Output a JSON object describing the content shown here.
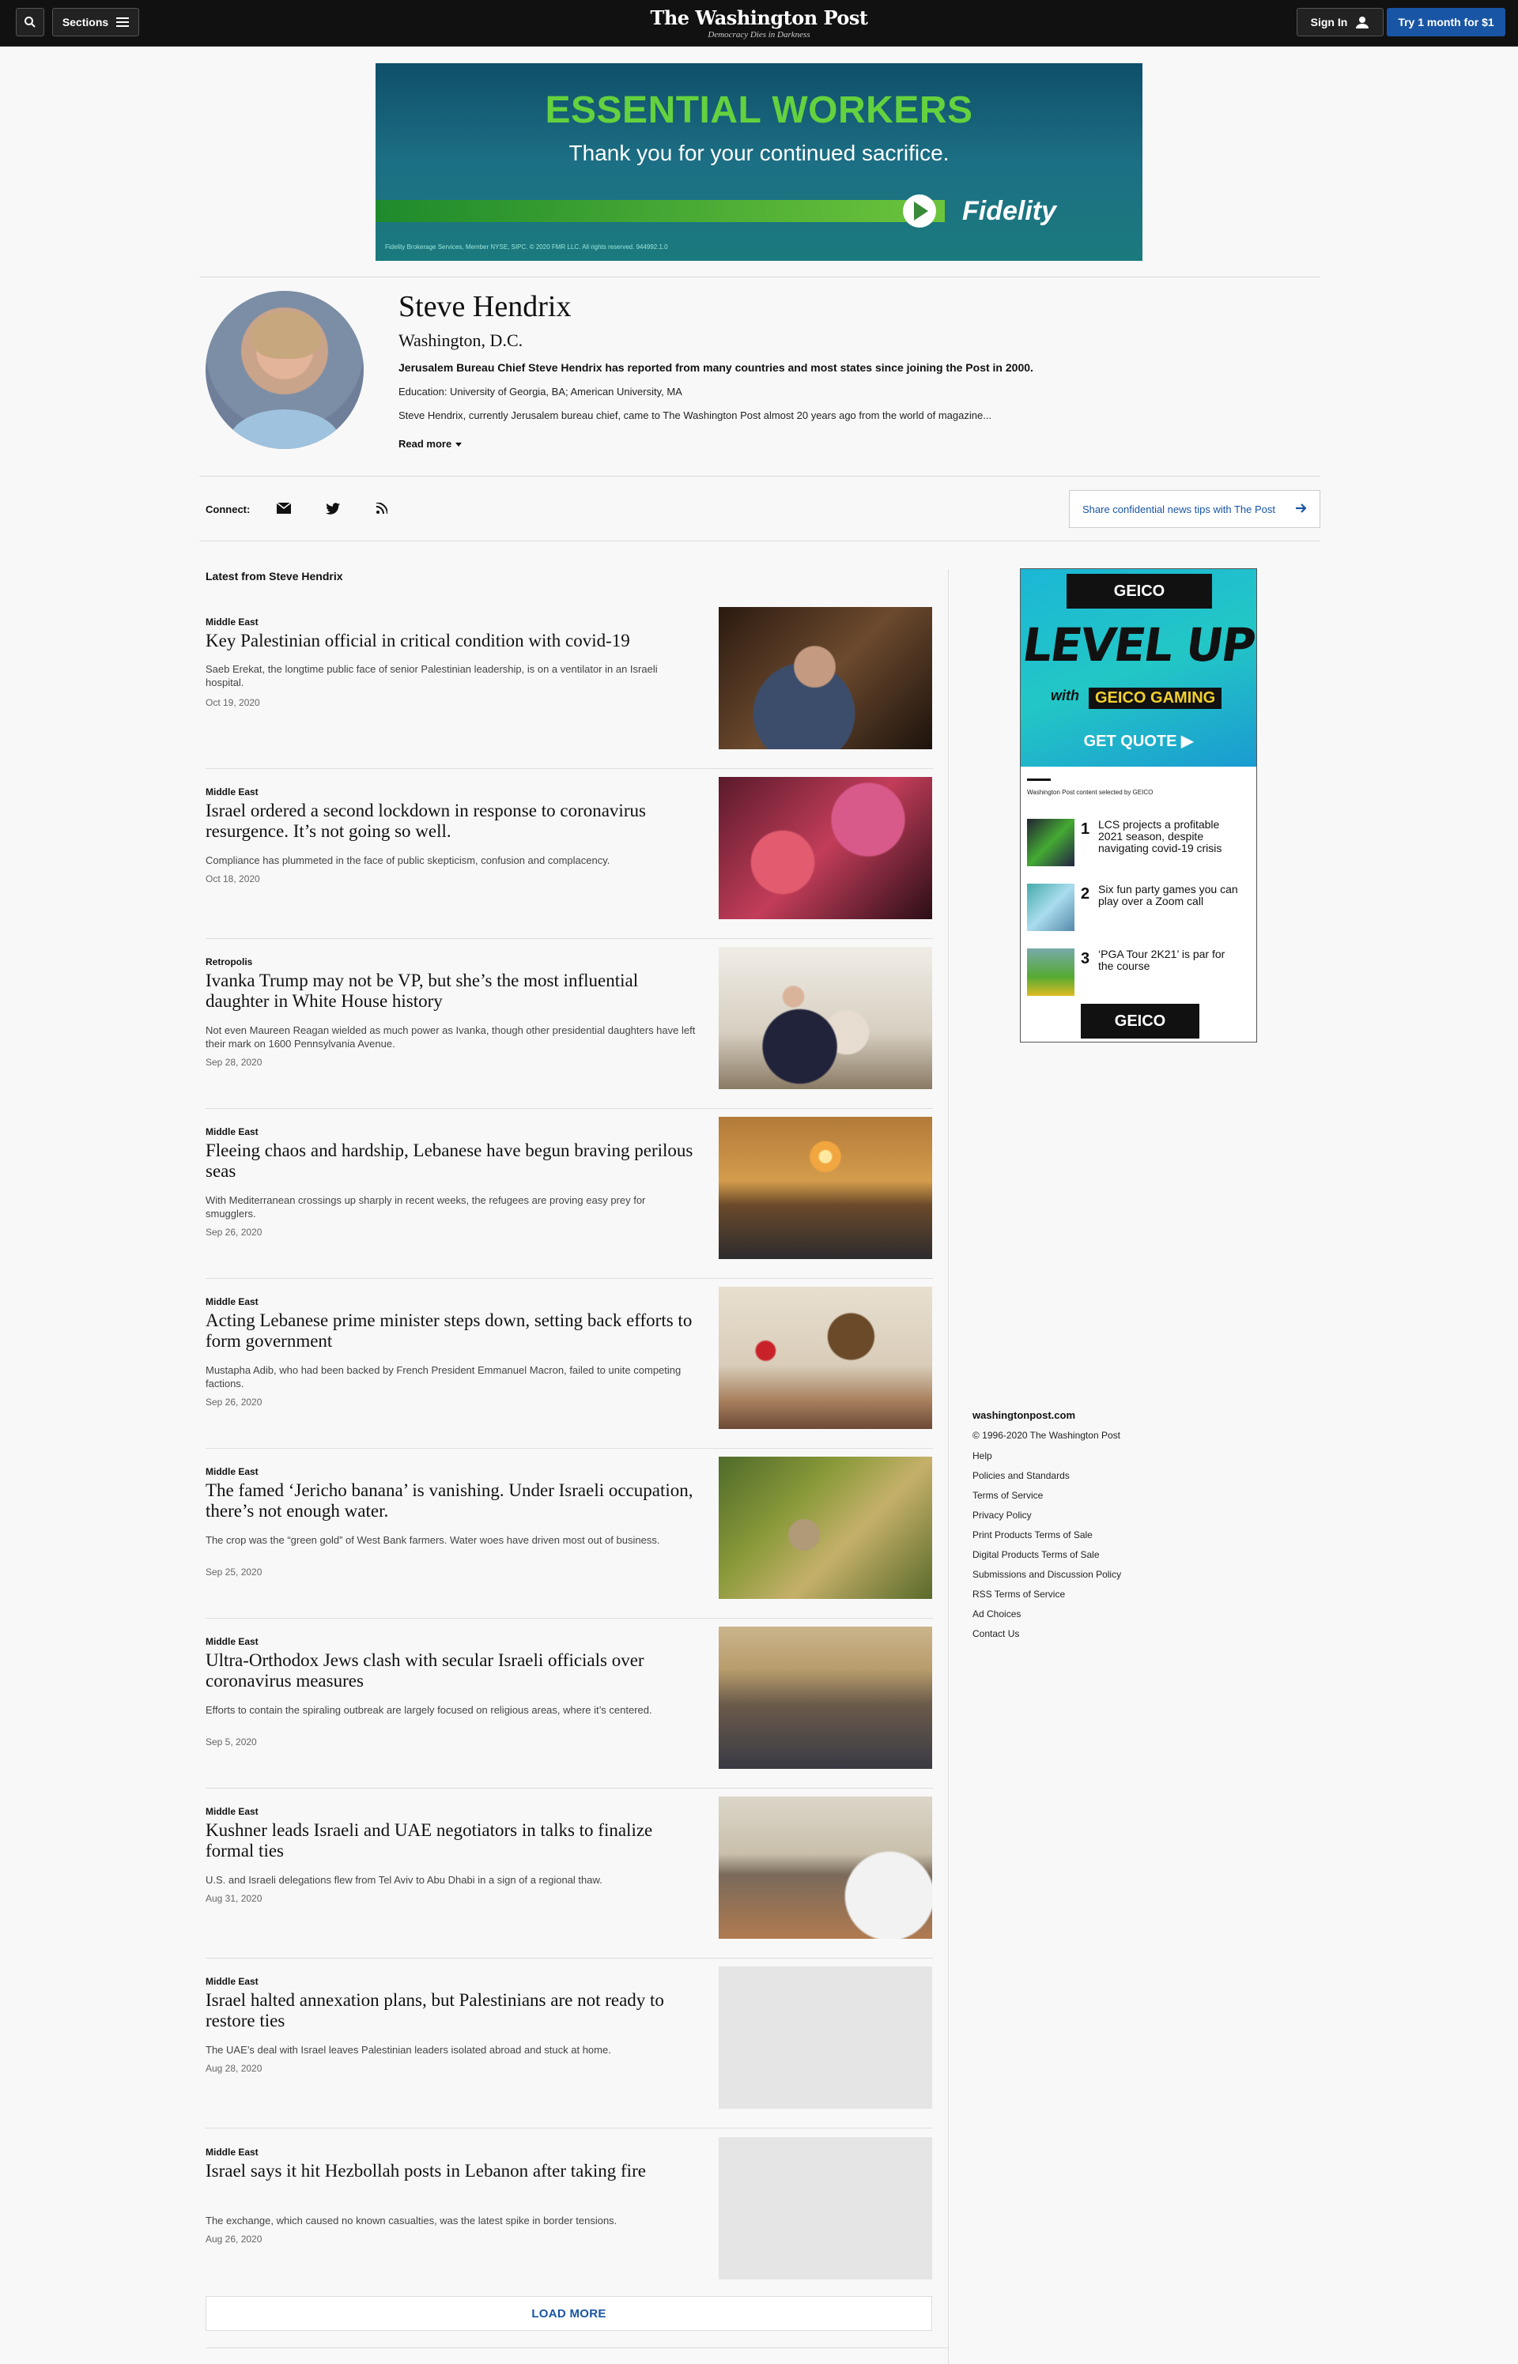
{
  "header": {
    "sections_label": "Sections",
    "brand": "The Washington Post",
    "tagline": "Democracy Dies in Darkness",
    "signin_label": "Sign In",
    "try_label": "Try 1 month for $1"
  },
  "top_ad": {
    "headline": "ESSENTIAL WORKERS",
    "subline": "Thank you for your continued sacrifice.",
    "brand": "Fidelity",
    "fine_print": "Fidelity Brokerage Services, Member NYSE, SIPC. © 2020 FMR LLC. All rights reserved. 944992.1.0"
  },
  "profile": {
    "name": "Steve Hendrix",
    "location": "Washington, D.C.",
    "bio": "Jerusalem Bureau Chief Steve Hendrix has reported from many countries and most states since joining the Post in 2000.",
    "education": "Education: University of Georgia, BA; American University, MA",
    "description": "Steve Hendrix, currently Jerusalem bureau chief, came to The Washington Post almost 20 years ago from the world of magazine...",
    "read_more": "Read more"
  },
  "connect": {
    "label": "Connect:",
    "share_text": "Share confidential news tips with The Post"
  },
  "latest_label": "Latest from Steve Hendrix",
  "articles": [
    {
      "kicker": "Middle East",
      "title": "Key Palestinian official in critical condition with covid-19",
      "blurb": "Saeb Erekat, the longtime public face of senior Palestinian leadership, is on a ventilator in an Israeli hospital.",
      "date": "Oct 19, 2020"
    },
    {
      "kicker": "Middle East",
      "title": "Israel ordered a second lockdown in response to coronavirus resurgence. It’s not going so well.",
      "blurb": "Compliance has plummeted in the face of public skepticism, confusion and complacency.",
      "date": "Oct 18, 2020"
    },
    {
      "kicker": "Retropolis",
      "title": "Ivanka Trump may not be VP, but she’s the most influential daughter in White House history",
      "blurb": "Not even Maureen Reagan wielded as much power as Ivanka, though other presidential daughters have left their mark on 1600 Pennsylvania Avenue.",
      "date": "Sep 28, 2020"
    },
    {
      "kicker": "Middle East",
      "title": "Fleeing chaos and hardship, Lebanese have begun braving perilous seas",
      "blurb": "With Mediterranean crossings up sharply in recent weeks, the refugees are proving easy prey for smugglers.",
      "date": "Sep 26, 2020"
    },
    {
      "kicker": "Middle East",
      "title": "Acting Lebanese prime minister steps down, setting back efforts to form government",
      "blurb": "Mustapha Adib, who had been backed by French President Emmanuel Macron, failed to unite competing factions.",
      "date": "Sep 26, 2020"
    },
    {
      "kicker": "Middle East",
      "title": "The famed ‘Jericho banana’ is vanishing. Under Israeli occupation, there’s not enough water.",
      "blurb": "The crop was the “green gold” of West Bank farmers. Water woes have driven most out of business.",
      "date": "Sep 25, 2020"
    },
    {
      "kicker": "Middle East",
      "title": "Ultra-Orthodox Jews clash with secular Israeli officials over coronavirus measures",
      "blurb": "Efforts to contain the spiraling outbreak are largely focused on religious areas, where it’s centered.",
      "date": "Sep 5, 2020"
    },
    {
      "kicker": "Middle East",
      "title": "Kushner leads Israeli and UAE negotiators in talks to finalize formal ties",
      "blurb": "U.S. and Israeli delegations flew from Tel Aviv to Abu Dhabi in a sign of a regional thaw.",
      "date": "Aug 31, 2020"
    },
    {
      "kicker": "Middle East",
      "title": "Israel halted annexation plans, but Palestinians are not ready to restore ties",
      "blurb": "The UAE’s deal with Israel leaves Palestinian leaders isolated abroad and stuck at home.",
      "date": "Aug 28, 2020"
    },
    {
      "kicker": "Middle East",
      "title": "Israel says it hit Hezbollah posts in Lebanon after taking fire",
      "blurb": "The exchange, which caused no known casualties, was the latest spike in border tensions.",
      "date": "Aug 26, 2020"
    }
  ],
  "load_more": "LOAD MORE",
  "right_ad": {
    "brand_top": "GEICO",
    "brand_top_sub": "GAMING",
    "headline": "LEVEL UP",
    "with": "with",
    "gaming": "GEICO GAMING",
    "cta": "GET QUOTE",
    "selected_by": "Washington Post content selected by GEICO",
    "items": [
      {
        "num": "1",
        "text": "LCS projects a profitable 2021 season, despite navigating covid-19 crisis"
      },
      {
        "num": "2",
        "text": "Six fun party games you can play over a Zoom call"
      },
      {
        "num": "3",
        "text": "‘PGA Tour 2K21’ is par for the course"
      }
    ],
    "brand_bottom": "GEICO"
  },
  "footer": {
    "site": "washingtonpost.com",
    "copyright": "© 1996-2020 The Washington Post",
    "links": [
      "Help",
      "Policies and Standards",
      "Terms of Service",
      "Privacy Policy",
      "Print Products Terms of Sale",
      "Digital Products Terms of Sale",
      "Submissions and Discussion Policy",
      "RSS Terms of Service",
      "Ad Choices",
      "Contact Us"
    ]
  }
}
